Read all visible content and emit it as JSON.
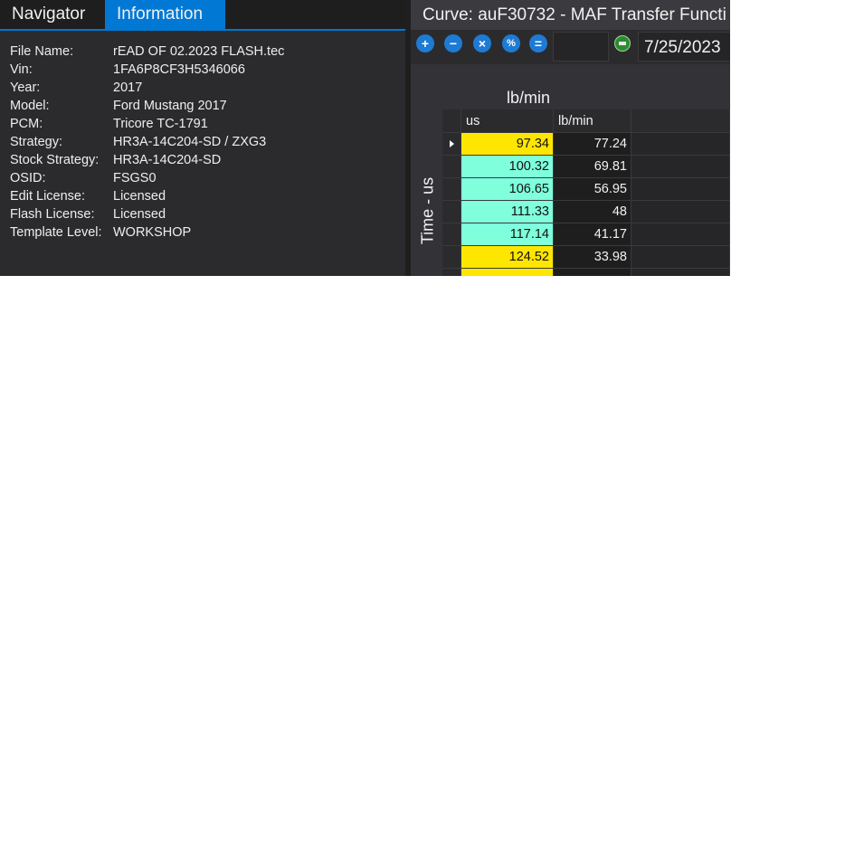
{
  "left_panel": {
    "tabs": [
      {
        "label": "Navigator"
      },
      {
        "label": "Information"
      }
    ],
    "info": [
      {
        "key": "File Name:",
        "value": "rEAD OF 02.2023 FLASH.tec"
      },
      {
        "key": "Vin:",
        "value": "1FA6P8CF3H5346066"
      },
      {
        "key": "Year:",
        "value": "2017"
      },
      {
        "key": "Model:",
        "value": "Ford Mustang 2017"
      },
      {
        "key": "PCM:",
        "value": "Tricore TC-1791"
      },
      {
        "key": "Strategy:",
        "value": "HR3A-14C204-SD / ZXG3"
      },
      {
        "key": "Stock Strategy:",
        "value": "HR3A-14C204-SD"
      },
      {
        "key": "OSID:",
        "value": "FSGS0"
      },
      {
        "key": "Edit License:",
        "value": "Licensed"
      },
      {
        "key": "Flash License:",
        "value": "Licensed"
      },
      {
        "key": "Template Level:",
        "value": "WORKSHOP"
      }
    ]
  },
  "right_panel": {
    "title": "Curve: auF30732 - MAF Transfer Functi",
    "toolbar": {
      "buttons": [
        {
          "icon": "plus-icon",
          "glyph": "+"
        },
        {
          "icon": "minus-icon",
          "glyph": "−"
        },
        {
          "icon": "multiply-icon",
          "glyph": "×"
        },
        {
          "icon": "percent-icon",
          "glyph": "%"
        },
        {
          "icon": "equals-icon",
          "glyph": "="
        }
      ],
      "date": "7/25/2023"
    },
    "y_axis_title": "lb/min",
    "x_axis_title": "Time - us",
    "table": {
      "headers": [
        "us",
        "lb/min"
      ],
      "rows": [
        {
          "us": "97.34",
          "lbmin": "77.24",
          "color": "#ffe600",
          "selected": true
        },
        {
          "us": "100.32",
          "lbmin": "69.81",
          "color": "#7fffdc",
          "selected": false
        },
        {
          "us": "106.65",
          "lbmin": "56.95",
          "color": "#7fffdc",
          "selected": false
        },
        {
          "us": "111.33",
          "lbmin": "48",
          "color": "#7fffdc",
          "selected": false
        },
        {
          "us": "117.14",
          "lbmin": "41.17",
          "color": "#7fffdc",
          "selected": false
        },
        {
          "us": "124.52",
          "lbmin": "33.98",
          "color": "#ffe600",
          "selected": false
        },
        {
          "us": "",
          "lbmin": "",
          "color": "#ffe600",
          "selected": false
        }
      ]
    }
  }
}
